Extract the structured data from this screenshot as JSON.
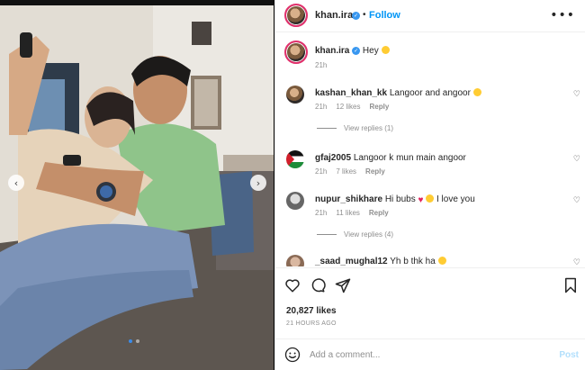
{
  "post": {
    "username": "khan.ira",
    "follow_label": "Follow",
    "more_label": "•••",
    "verified_mark": "✓"
  },
  "caption": {
    "username": "khan.ira",
    "text": "Hey",
    "time": "21h"
  },
  "comments": [
    {
      "username": "kashan_khan_kk",
      "text": "Langoor and angoor",
      "time": "21h",
      "likes": "12 likes",
      "reply": "Reply",
      "replies": "View replies (1)"
    },
    {
      "username": "gfaj2005",
      "text": "Langoor k mun main angoor",
      "time": "21h",
      "likes": "7 likes",
      "reply": "Reply",
      "replies": ""
    },
    {
      "username": "nupur_shikhare",
      "text": "Hi bubs",
      "text2": "I love you",
      "time": "21h",
      "likes": "11 likes",
      "reply": "Reply",
      "replies": "View replies (4)"
    },
    {
      "username": "_saad_mughal12",
      "text": "Yh b thk ha",
      "time": "",
      "likes": "",
      "reply": "",
      "replies": ""
    }
  ],
  "actions": {
    "likes": "20,827 likes",
    "time": "21 HOURS AGO"
  },
  "comment_box": {
    "placeholder": "Add a comment...",
    "post_label": "Post"
  },
  "colors": {
    "accent": "#0095f6",
    "verified": "#3897f0",
    "muted": "#8e8e8e"
  },
  "icons": [
    "heart-icon",
    "comment-icon",
    "share-icon",
    "bookmark-icon",
    "emoji-icon",
    "chevron-left-icon",
    "chevron-right-icon",
    "more-icon"
  ],
  "carousel": {
    "slides": 2,
    "active": 1
  }
}
